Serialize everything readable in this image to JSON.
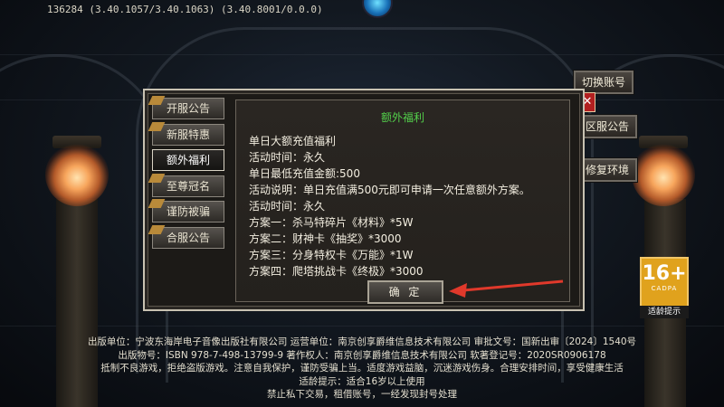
{
  "version_text": "136284 (3.40.1057/3.40.1063) (3.40.8001/0.0.0)",
  "side_buttons": {
    "switch_account": "切换账号",
    "close": "✕",
    "server_notice": "区服公告",
    "repair_env": "修复环境"
  },
  "dialog": {
    "tabs": [
      {
        "label": "开服公告",
        "ribbon": true
      },
      {
        "label": "新服特惠",
        "ribbon": true
      },
      {
        "label": "额外福利",
        "ribbon": false,
        "active": true
      },
      {
        "label": "至尊冠名",
        "ribbon": true
      },
      {
        "label": "谨防被骗",
        "ribbon": true
      },
      {
        "label": "合服公告",
        "ribbon": true
      }
    ],
    "title": "额外福利",
    "lines": [
      "单日大额充值福利",
      "活动时间：永久",
      "单日最低充值金额:500",
      "活动说明：单日充值满500元即可申请一次任意额外方案。",
      "活动时间：永久",
      "方案一：杀马特碎片《材料》*5W",
      "方案二：财神卡《抽奖》*3000",
      "方案三：分身特权卡《万能》*1W",
      "方案四：爬塔挑战卡《终极》*3000"
    ],
    "confirm_label": "确 定",
    "title_color": "#53d04b"
  },
  "age_rating": {
    "number": "16+",
    "org": "CADPA",
    "tip": "适龄提示"
  },
  "footer": [
    "出版单位：宁波东海岸电子音像出版社有限公司 运营单位：南京创享爵维信息技术有限公司 审批文号：国新出审〔2024〕1540号",
    "出版物号：ISBN 978-7-498-13799-9 著作权人：南京创享爵维信息技术有限公司 软著登记号：2020SR0906178",
    "抵制不良游戏，拒绝盗版游戏。注意自我保护，谨防受骗上当。适度游戏益脑，沉迷游戏伤身。合理安排时间，享受健康生活",
    "适龄提示：适合16岁以上使用",
    "禁止私下交易，租借账号，一经发现封号处理"
  ],
  "colors": {
    "arrow": "#e0392b",
    "age_badge": "#e0a21d"
  }
}
